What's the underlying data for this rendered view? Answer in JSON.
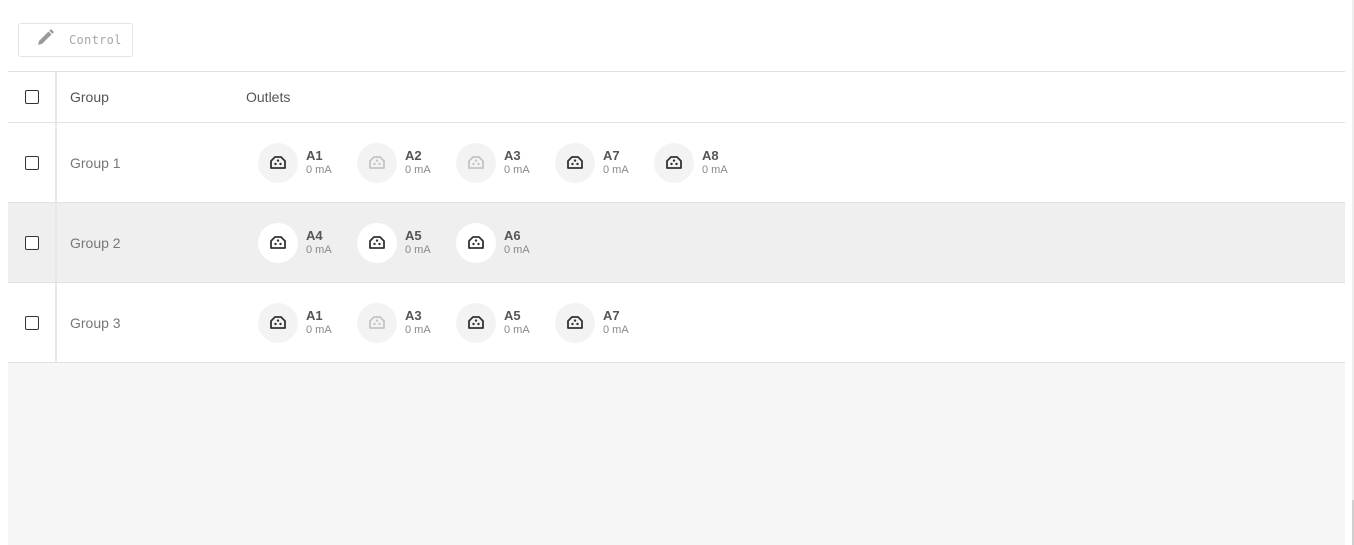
{
  "toolbar": {
    "control_label": "Control",
    "control_icon": "pencil-icon"
  },
  "table": {
    "headers": {
      "group": "Group",
      "outlets": "Outlets"
    },
    "rows": [
      {
        "group": "Group 1",
        "highlighted": false,
        "outlets": [
          {
            "name": "A1",
            "current": "0 mA",
            "on": true
          },
          {
            "name": "A2",
            "current": "0 mA",
            "on": false
          },
          {
            "name": "A3",
            "current": "0 mA",
            "on": false
          },
          {
            "name": "A7",
            "current": "0 mA",
            "on": true
          },
          {
            "name": "A8",
            "current": "0 mA",
            "on": true
          }
        ]
      },
      {
        "group": "Group 2",
        "highlighted": true,
        "outlets": [
          {
            "name": "A4",
            "current": "0 mA",
            "on": true
          },
          {
            "name": "A5",
            "current": "0 mA",
            "on": true
          },
          {
            "name": "A6",
            "current": "0 mA",
            "on": true
          }
        ]
      },
      {
        "group": "Group 3",
        "highlighted": false,
        "outlets": [
          {
            "name": "A1",
            "current": "0 mA",
            "on": true
          },
          {
            "name": "A3",
            "current": "0 mA",
            "on": false
          },
          {
            "name": "A5",
            "current": "0 mA",
            "on": true
          },
          {
            "name": "A7",
            "current": "0 mA",
            "on": true
          }
        ]
      }
    ]
  },
  "colors": {
    "highlight_row": "#eeefee",
    "outlet_on": "#333333",
    "outlet_off": "#c4c4c4"
  }
}
